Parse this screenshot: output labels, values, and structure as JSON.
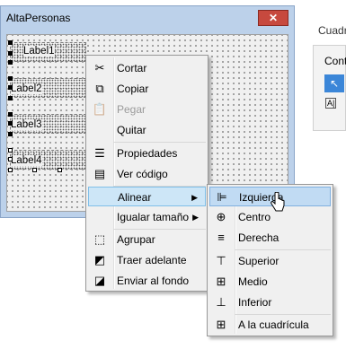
{
  "window": {
    "title": "AltaPersonas",
    "close_symbol": "✕"
  },
  "form_labels": [
    "Label1",
    "Label2",
    "Label3",
    "Label4"
  ],
  "right_panel": {
    "title": "Cuadr",
    "toolbox_title": "Contr",
    "arrow_tool": "↖",
    "label_tool": "A|"
  },
  "context_menu": {
    "items": [
      {
        "label": "Cortar",
        "icon": "scissors-icon",
        "glyph": "✂",
        "enabled": true
      },
      {
        "label": "Copiar",
        "icon": "copy-icon",
        "glyph": "⧉",
        "enabled": true
      },
      {
        "label": "Pegar",
        "icon": "paste-icon",
        "glyph": "📋",
        "enabled": false
      },
      {
        "label": "Quitar",
        "icon": "",
        "glyph": "",
        "enabled": true
      },
      {
        "label": "Propiedades",
        "icon": "properties-icon",
        "glyph": "☰",
        "enabled": true
      },
      {
        "label": "Ver código",
        "icon": "view-code-icon",
        "glyph": "▤",
        "enabled": true
      },
      {
        "label": "Alinear",
        "icon": "",
        "glyph": "",
        "enabled": true,
        "submenu": true,
        "arrow": "▶"
      },
      {
        "label": "Igualar tamaño",
        "icon": "",
        "glyph": "",
        "enabled": true,
        "submenu": true,
        "arrow": "▶"
      },
      {
        "label": "Agrupar",
        "icon": "group-icon",
        "glyph": "⬚",
        "enabled": true
      },
      {
        "label": "Traer adelante",
        "icon": "bring-front-icon",
        "glyph": "◩",
        "enabled": true
      },
      {
        "label": "Enviar al fondo",
        "icon": "send-back-icon",
        "glyph": "◪",
        "enabled": true
      }
    ]
  },
  "align_submenu": {
    "items": [
      {
        "label": "Izquierda",
        "icon": "align-left-icon",
        "glyph": "⊫"
      },
      {
        "label": "Centro",
        "icon": "align-center-icon",
        "glyph": "⊕"
      },
      {
        "label": "Derecha",
        "icon": "align-right-icon",
        "glyph": "≡"
      },
      {
        "label": "Superior",
        "icon": "align-top-icon",
        "glyph": "⊤"
      },
      {
        "label": "Medio",
        "icon": "align-middle-icon",
        "glyph": "⊞"
      },
      {
        "label": "Inferior",
        "icon": "align-bottom-icon",
        "glyph": "⊥"
      },
      {
        "label": "A la cuadrícula",
        "icon": "align-grid-icon",
        "glyph": "⊞"
      }
    ]
  }
}
